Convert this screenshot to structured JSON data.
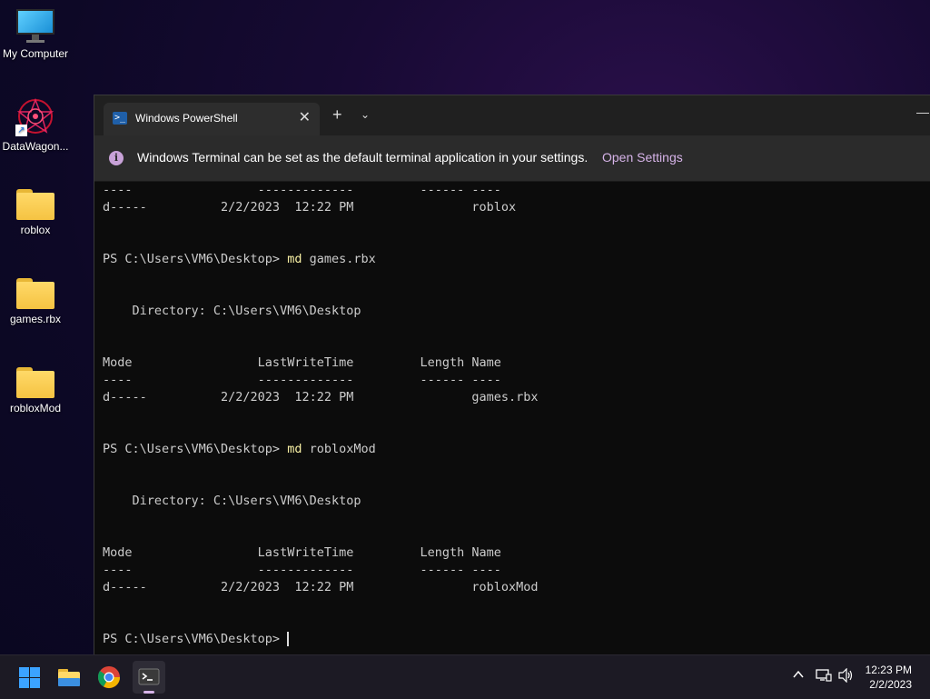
{
  "desktop": {
    "icons": [
      {
        "label": "My Computer"
      },
      {
        "label": "DataWagon..."
      },
      {
        "label": "roblox"
      },
      {
        "label": "games.rbx"
      },
      {
        "label": "robloxMod"
      }
    ]
  },
  "window": {
    "tab_title": "Windows PowerShell",
    "tab_close": "✕",
    "new_tab": "+",
    "dropdown": "⌄",
    "minimize": "—"
  },
  "infobar": {
    "message": "Windows Terminal can be set as the default terminal application in your settings.",
    "link": "Open Settings"
  },
  "console": {
    "lines": [
      {
        "text": "----                 -------------         ------ ----"
      },
      {
        "text": "d-----          2/2/2023  12:22 PM                roblox"
      },
      {
        "text": ""
      },
      {
        "text": ""
      },
      {
        "prompt": "PS C:\\Users\\VM6\\Desktop> ",
        "cmd": "md",
        "arg": " games.rbx"
      },
      {
        "text": ""
      },
      {
        "text": ""
      },
      {
        "text": "    Directory: C:\\Users\\VM6\\Desktop"
      },
      {
        "text": ""
      },
      {
        "text": ""
      },
      {
        "text": "Mode                 LastWriteTime         Length Name"
      },
      {
        "text": "----                 -------------         ------ ----"
      },
      {
        "text": "d-----          2/2/2023  12:22 PM                games.rbx"
      },
      {
        "text": ""
      },
      {
        "text": ""
      },
      {
        "prompt": "PS C:\\Users\\VM6\\Desktop> ",
        "cmd": "md",
        "arg": " robloxMod"
      },
      {
        "text": ""
      },
      {
        "text": ""
      },
      {
        "text": "    Directory: C:\\Users\\VM6\\Desktop"
      },
      {
        "text": ""
      },
      {
        "text": ""
      },
      {
        "text": "Mode                 LastWriteTime         Length Name"
      },
      {
        "text": "----                 -------------         ------ ----"
      },
      {
        "text": "d-----          2/2/2023  12:22 PM                robloxMod"
      },
      {
        "text": ""
      },
      {
        "text": ""
      },
      {
        "prompt": "PS C:\\Users\\VM6\\Desktop> ",
        "cursor": true
      }
    ]
  },
  "taskbar": {
    "icons": [
      "windows-start-icon",
      "file-explorer-icon",
      "chrome-icon",
      "terminal-icon"
    ],
    "tray_chevron": "^",
    "tray_network": "▭",
    "tray_volume": "🔊",
    "time": "12:23 PM",
    "date": "2/2/2023"
  },
  "colors": {
    "accent": "#d6b3e8",
    "command": "#f9f1a5",
    "terminal_bg": "#0c0c0c",
    "folder": "#f5c342"
  }
}
